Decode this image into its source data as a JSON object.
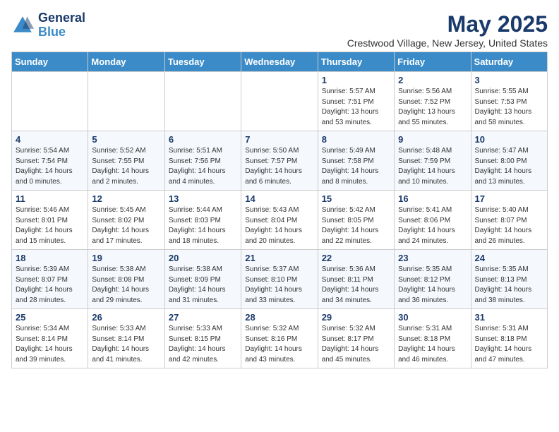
{
  "header": {
    "logo_line1": "General",
    "logo_line2": "Blue",
    "month": "May 2025",
    "location": "Crestwood Village, New Jersey, United States"
  },
  "days_of_week": [
    "Sunday",
    "Monday",
    "Tuesday",
    "Wednesday",
    "Thursday",
    "Friday",
    "Saturday"
  ],
  "weeks": [
    [
      {
        "day": "",
        "info": ""
      },
      {
        "day": "",
        "info": ""
      },
      {
        "day": "",
        "info": ""
      },
      {
        "day": "",
        "info": ""
      },
      {
        "day": "1",
        "info": "Sunrise: 5:57 AM\nSunset: 7:51 PM\nDaylight: 13 hours\nand 53 minutes."
      },
      {
        "day": "2",
        "info": "Sunrise: 5:56 AM\nSunset: 7:52 PM\nDaylight: 13 hours\nand 55 minutes."
      },
      {
        "day": "3",
        "info": "Sunrise: 5:55 AM\nSunset: 7:53 PM\nDaylight: 13 hours\nand 58 minutes."
      }
    ],
    [
      {
        "day": "4",
        "info": "Sunrise: 5:54 AM\nSunset: 7:54 PM\nDaylight: 14 hours\nand 0 minutes."
      },
      {
        "day": "5",
        "info": "Sunrise: 5:52 AM\nSunset: 7:55 PM\nDaylight: 14 hours\nand 2 minutes."
      },
      {
        "day": "6",
        "info": "Sunrise: 5:51 AM\nSunset: 7:56 PM\nDaylight: 14 hours\nand 4 minutes."
      },
      {
        "day": "7",
        "info": "Sunrise: 5:50 AM\nSunset: 7:57 PM\nDaylight: 14 hours\nand 6 minutes."
      },
      {
        "day": "8",
        "info": "Sunrise: 5:49 AM\nSunset: 7:58 PM\nDaylight: 14 hours\nand 8 minutes."
      },
      {
        "day": "9",
        "info": "Sunrise: 5:48 AM\nSunset: 7:59 PM\nDaylight: 14 hours\nand 10 minutes."
      },
      {
        "day": "10",
        "info": "Sunrise: 5:47 AM\nSunset: 8:00 PM\nDaylight: 14 hours\nand 13 minutes."
      }
    ],
    [
      {
        "day": "11",
        "info": "Sunrise: 5:46 AM\nSunset: 8:01 PM\nDaylight: 14 hours\nand 15 minutes."
      },
      {
        "day": "12",
        "info": "Sunrise: 5:45 AM\nSunset: 8:02 PM\nDaylight: 14 hours\nand 17 minutes."
      },
      {
        "day": "13",
        "info": "Sunrise: 5:44 AM\nSunset: 8:03 PM\nDaylight: 14 hours\nand 18 minutes."
      },
      {
        "day": "14",
        "info": "Sunrise: 5:43 AM\nSunset: 8:04 PM\nDaylight: 14 hours\nand 20 minutes."
      },
      {
        "day": "15",
        "info": "Sunrise: 5:42 AM\nSunset: 8:05 PM\nDaylight: 14 hours\nand 22 minutes."
      },
      {
        "day": "16",
        "info": "Sunrise: 5:41 AM\nSunset: 8:06 PM\nDaylight: 14 hours\nand 24 minutes."
      },
      {
        "day": "17",
        "info": "Sunrise: 5:40 AM\nSunset: 8:07 PM\nDaylight: 14 hours\nand 26 minutes."
      }
    ],
    [
      {
        "day": "18",
        "info": "Sunrise: 5:39 AM\nSunset: 8:07 PM\nDaylight: 14 hours\nand 28 minutes."
      },
      {
        "day": "19",
        "info": "Sunrise: 5:38 AM\nSunset: 8:08 PM\nDaylight: 14 hours\nand 29 minutes."
      },
      {
        "day": "20",
        "info": "Sunrise: 5:38 AM\nSunset: 8:09 PM\nDaylight: 14 hours\nand 31 minutes."
      },
      {
        "day": "21",
        "info": "Sunrise: 5:37 AM\nSunset: 8:10 PM\nDaylight: 14 hours\nand 33 minutes."
      },
      {
        "day": "22",
        "info": "Sunrise: 5:36 AM\nSunset: 8:11 PM\nDaylight: 14 hours\nand 34 minutes."
      },
      {
        "day": "23",
        "info": "Sunrise: 5:35 AM\nSunset: 8:12 PM\nDaylight: 14 hours\nand 36 minutes."
      },
      {
        "day": "24",
        "info": "Sunrise: 5:35 AM\nSunset: 8:13 PM\nDaylight: 14 hours\nand 38 minutes."
      }
    ],
    [
      {
        "day": "25",
        "info": "Sunrise: 5:34 AM\nSunset: 8:14 PM\nDaylight: 14 hours\nand 39 minutes."
      },
      {
        "day": "26",
        "info": "Sunrise: 5:33 AM\nSunset: 8:14 PM\nDaylight: 14 hours\nand 41 minutes."
      },
      {
        "day": "27",
        "info": "Sunrise: 5:33 AM\nSunset: 8:15 PM\nDaylight: 14 hours\nand 42 minutes."
      },
      {
        "day": "28",
        "info": "Sunrise: 5:32 AM\nSunset: 8:16 PM\nDaylight: 14 hours\nand 43 minutes."
      },
      {
        "day": "29",
        "info": "Sunrise: 5:32 AM\nSunset: 8:17 PM\nDaylight: 14 hours\nand 45 minutes."
      },
      {
        "day": "30",
        "info": "Sunrise: 5:31 AM\nSunset: 8:18 PM\nDaylight: 14 hours\nand 46 minutes."
      },
      {
        "day": "31",
        "info": "Sunrise: 5:31 AM\nSunset: 8:18 PM\nDaylight: 14 hours\nand 47 minutes."
      }
    ]
  ]
}
